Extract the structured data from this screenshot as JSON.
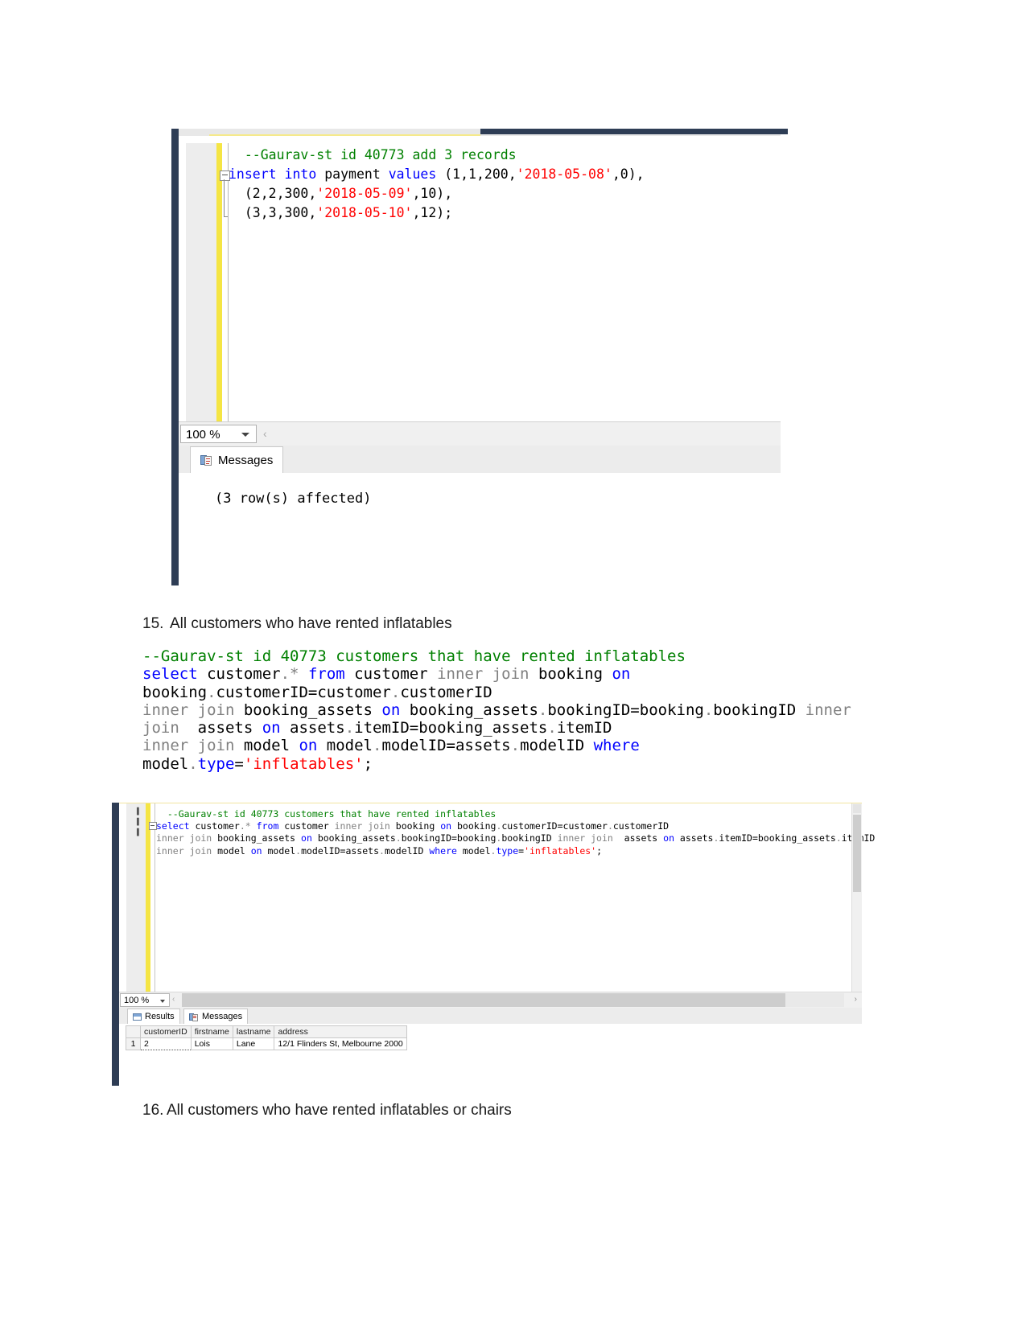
{
  "screenshot1": {
    "zoom_level": "100 %",
    "tabs": [
      {
        "label": "Messages",
        "icon": "messages-icon"
      }
    ],
    "message_text": "(3 row(s) affected)",
    "code_lines": [
      [
        {
          "t": "  --Gaurav-st id 40773 add 3 records",
          "c": "com"
        }
      ],
      [
        {
          "t": "insert into",
          "c": "kw"
        },
        {
          "t": " payment ",
          "c": "txt"
        },
        {
          "t": "values",
          "c": "kw"
        },
        {
          "t": " (1,1,200,",
          "c": "txt"
        },
        {
          "t": "'2018-05-08'",
          "c": "str"
        },
        {
          "t": ",0),",
          "c": "txt"
        }
      ],
      [
        {
          "t": "  (2,2,300,",
          "c": "txt"
        },
        {
          "t": "'2018-05-09'",
          "c": "str"
        },
        {
          "t": ",10),",
          "c": "txt"
        }
      ],
      [
        {
          "t": "  (3,3,300,",
          "c": "txt"
        },
        {
          "t": "'2018-05-10'",
          "c": "str"
        },
        {
          "t": ",12);",
          "c": "txt"
        }
      ]
    ]
  },
  "section15": {
    "number": "15.",
    "title": "All customers who have rented inflatables",
    "code": [
      [
        {
          "t": "--Gaurav-st id 40773 customers that have rented inflatables",
          "c": "com"
        }
      ],
      [
        {
          "t": "select",
          "c": "kw"
        },
        {
          "t": " customer",
          "c": "txt"
        },
        {
          "t": ".",
          "c": "gray"
        },
        {
          "t": "*",
          "c": "gray"
        },
        {
          "t": " ",
          "c": "txt"
        },
        {
          "t": "from",
          "c": "kw"
        },
        {
          "t": " customer ",
          "c": "txt"
        },
        {
          "t": "inner join",
          "c": "gray"
        },
        {
          "t": " booking ",
          "c": "txt"
        },
        {
          "t": "on",
          "c": "kw"
        },
        {
          "t": " booking",
          "c": "txt"
        },
        {
          "t": ".",
          "c": "gray"
        },
        {
          "t": "customerID=customer",
          "c": "txt"
        },
        {
          "t": ".",
          "c": "gray"
        },
        {
          "t": "customerID",
          "c": "txt"
        }
      ],
      [
        {
          "t": "inner join",
          "c": "gray"
        },
        {
          "t": " booking_assets ",
          "c": "txt"
        },
        {
          "t": "on",
          "c": "kw"
        },
        {
          "t": " booking_assets",
          "c": "txt"
        },
        {
          "t": ".",
          "c": "gray"
        },
        {
          "t": "bookingID=booking",
          "c": "txt"
        },
        {
          "t": ".",
          "c": "gray"
        },
        {
          "t": "bookingID ",
          "c": "txt"
        },
        {
          "t": "inner join",
          "c": "gray"
        },
        {
          "t": "  assets ",
          "c": "txt"
        },
        {
          "t": "on",
          "c": "kw"
        },
        {
          "t": " assets",
          "c": "txt"
        },
        {
          "t": ".",
          "c": "gray"
        },
        {
          "t": "itemID=booking_assets",
          "c": "txt"
        },
        {
          "t": ".",
          "c": "gray"
        },
        {
          "t": "itemID",
          "c": "txt"
        }
      ],
      [
        {
          "t": "inner join",
          "c": "gray"
        },
        {
          "t": " model ",
          "c": "txt"
        },
        {
          "t": "on",
          "c": "kw"
        },
        {
          "t": " model",
          "c": "txt"
        },
        {
          "t": ".",
          "c": "gray"
        },
        {
          "t": "modelID=assets",
          "c": "txt"
        },
        {
          "t": ".",
          "c": "gray"
        },
        {
          "t": "modelID ",
          "c": "txt"
        },
        {
          "t": "where",
          "c": "kw"
        },
        {
          "t": " model",
          "c": "txt"
        },
        {
          "t": ".",
          "c": "gray"
        },
        {
          "t": "type",
          "c": "kw"
        },
        {
          "t": "=",
          "c": "txt"
        },
        {
          "t": "'inflatables'",
          "c": "str"
        },
        {
          "t": ";",
          "c": "txt"
        }
      ]
    ]
  },
  "screenshot2": {
    "zoom_level": "100 %",
    "tabs": [
      {
        "label": "Results",
        "icon": "results-grid-icon"
      },
      {
        "label": "Messages",
        "icon": "messages-icon"
      }
    ],
    "code_lines": [
      [
        {
          "t": "  --Gaurav-st id 40773 customers that have rented inflatables",
          "c": "com"
        }
      ],
      [
        {
          "t": "select",
          "c": "kw"
        },
        {
          "t": " customer",
          "c": "txt"
        },
        {
          "t": ".",
          "c": "gray"
        },
        {
          "t": "*",
          "c": "gray"
        },
        {
          "t": " ",
          "c": "txt"
        },
        {
          "t": "from",
          "c": "kw"
        },
        {
          "t": " customer ",
          "c": "txt"
        },
        {
          "t": "inner join",
          "c": "gray"
        },
        {
          "t": " booking ",
          "c": "txt"
        },
        {
          "t": "on",
          "c": "kw"
        },
        {
          "t": " booking",
          "c": "txt"
        },
        {
          "t": ".",
          "c": "gray"
        },
        {
          "t": "customerID=customer",
          "c": "txt"
        },
        {
          "t": ".",
          "c": "gray"
        },
        {
          "t": "customerID",
          "c": "txt"
        }
      ],
      [
        {
          "t": "inner join",
          "c": "gray"
        },
        {
          "t": " booking_assets ",
          "c": "txt"
        },
        {
          "t": "on",
          "c": "kw"
        },
        {
          "t": " booking_assets",
          "c": "txt"
        },
        {
          "t": ".",
          "c": "gray"
        },
        {
          "t": "bookingID=booking",
          "c": "txt"
        },
        {
          "t": ".",
          "c": "gray"
        },
        {
          "t": "bookingID ",
          "c": "txt"
        },
        {
          "t": "inner join",
          "c": "gray"
        },
        {
          "t": "  assets ",
          "c": "txt"
        },
        {
          "t": "on",
          "c": "kw"
        },
        {
          "t": " assets",
          "c": "txt"
        },
        {
          "t": ".",
          "c": "gray"
        },
        {
          "t": "itemID=booking_assets",
          "c": "txt"
        },
        {
          "t": ".",
          "c": "gray"
        },
        {
          "t": "itemID",
          "c": "txt"
        }
      ],
      [
        {
          "t": "inner join",
          "c": "gray"
        },
        {
          "t": " model ",
          "c": "txt"
        },
        {
          "t": "on",
          "c": "kw"
        },
        {
          "t": " model",
          "c": "txt"
        },
        {
          "t": ".",
          "c": "gray"
        },
        {
          "t": "modelID=assets",
          "c": "txt"
        },
        {
          "t": ".",
          "c": "gray"
        },
        {
          "t": "modelID ",
          "c": "txt"
        },
        {
          "t": "where",
          "c": "kw"
        },
        {
          "t": " model",
          "c": "txt"
        },
        {
          "t": ".",
          "c": "gray"
        },
        {
          "t": "type",
          "c": "kw"
        },
        {
          "t": "=",
          "c": "txt"
        },
        {
          "t": "'inflatables'",
          "c": "str"
        },
        {
          "t": ";",
          "c": "txt"
        }
      ]
    ],
    "results": {
      "columns": [
        "customerID",
        "firstname",
        "lastname",
        "address"
      ],
      "rows": [
        {
          "num": "1",
          "cells": [
            "2",
            "Lois",
            "Lane",
            "12/1 Flinders St, Melbourne 2000"
          ]
        }
      ]
    }
  },
  "section16": {
    "number": "16.",
    "title": "All customers who have rented inflatables or chairs"
  }
}
